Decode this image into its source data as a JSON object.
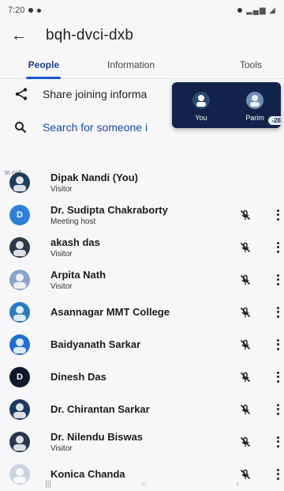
{
  "status_bar": {
    "time": "7:20",
    "signal_text": ""
  },
  "appbar": {
    "title": "bqh-dvci-dxb"
  },
  "tabs": [
    {
      "label": "People"
    },
    {
      "label": "Information"
    },
    {
      "label": "Tools"
    }
  ],
  "actions": {
    "share_label": "Share joining informa",
    "search_placeholder": "Search for someone i"
  },
  "pip": {
    "you_label": "You",
    "parim_label": "Parim",
    "parim_badge": "-28"
  },
  "section": {
    "in_call": "In call"
  },
  "participants": [
    {
      "name": "Dipak Nandi (You)",
      "role": "Visitor",
      "avatar_color": "#1f3d5c",
      "initial": "",
      "show_controls": false
    },
    {
      "name": "Dr. Sudipta Chakraborty",
      "role": "Meeting host",
      "avatar_color": "#2f7fd6",
      "initial": "D",
      "show_controls": true
    },
    {
      "name": "akash das",
      "role": "Visitor",
      "avatar_color": "#2b3a4a",
      "initial": "",
      "show_controls": true
    },
    {
      "name": "Arpita Nath",
      "role": "Visitor",
      "avatar_color": "#8aa4c8",
      "initial": "",
      "show_controls": true
    },
    {
      "name": "Asannagar MMT College",
      "role": "",
      "avatar_color": "#2a7ac0",
      "initial": "",
      "show_controls": true
    },
    {
      "name": "Baidyanath Sarkar",
      "role": "",
      "avatar_color": "#1e6fd0",
      "initial": "",
      "show_controls": true
    },
    {
      "name": "Dinesh Das",
      "role": "",
      "avatar_color": "#111a2c",
      "initial": "D",
      "show_controls": true
    },
    {
      "name": "Dr. Chirantan Sarkar",
      "role": "",
      "avatar_color": "#1d3a5e",
      "initial": "",
      "show_controls": true
    },
    {
      "name": "Dr. Nilendu Biswas",
      "role": "Visitor",
      "avatar_color": "#27384d",
      "initial": "",
      "show_controls": true
    },
    {
      "name": "Konica Chanda",
      "role": "",
      "avatar_color": "#c9d2de",
      "initial": "",
      "show_controls": true
    }
  ],
  "colors": {
    "accent": "#1a56db",
    "pip_bg": "#13224a"
  }
}
